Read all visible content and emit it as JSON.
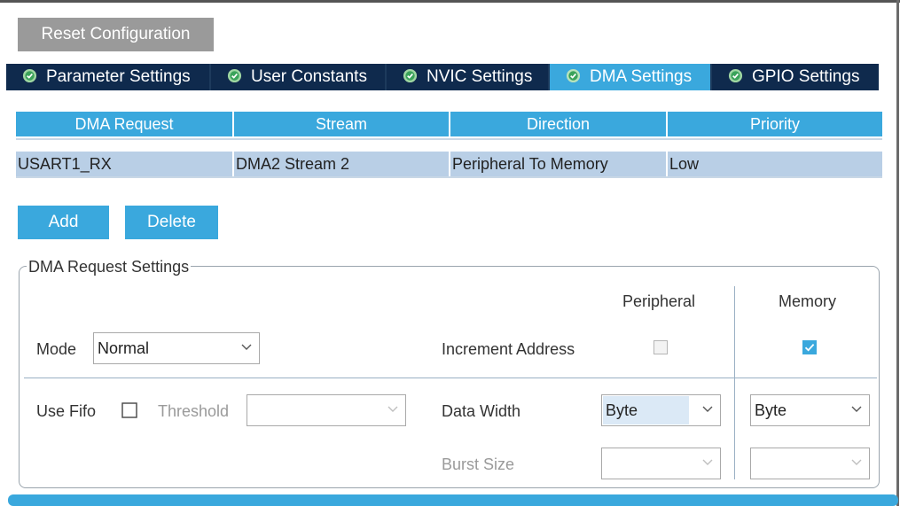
{
  "toolbar": {
    "reset_label": "Reset Configuration"
  },
  "tabs": [
    {
      "label": "Parameter Settings",
      "active": false
    },
    {
      "label": "User Constants",
      "active": false
    },
    {
      "label": "NVIC Settings",
      "active": false
    },
    {
      "label": "DMA Settings",
      "active": true
    },
    {
      "label": "GPIO Settings",
      "active": false
    }
  ],
  "dma_table": {
    "headers": [
      "DMA Request",
      "Stream",
      "Direction",
      "Priority"
    ],
    "rows": [
      [
        "USART1_RX",
        "DMA2 Stream 2",
        "Peripheral To Memory",
        "Low"
      ]
    ]
  },
  "actions": {
    "add_label": "Add",
    "delete_label": "Delete"
  },
  "request_settings": {
    "title": "DMA Request Settings",
    "peripheral_header": "Peripheral",
    "memory_header": "Memory",
    "mode_label": "Mode",
    "mode_value": "Normal",
    "increment_label": "Increment Address",
    "peripheral_increment": false,
    "memory_increment": true,
    "use_fifo_label": "Use Fifo",
    "use_fifo": false,
    "threshold_label": "Threshold",
    "threshold_value": "",
    "data_width_label": "Data Width",
    "peripheral_data_width": "Byte",
    "memory_data_width": "Byte",
    "burst_size_label": "Burst Size",
    "peripheral_burst": "",
    "memory_burst": ""
  },
  "icons": {
    "tab_status": "check-circle-icon",
    "dropdown": "chevron-down-icon",
    "checkbox": "checkbox-icon"
  },
  "colors": {
    "accent": "#3aa8dd",
    "tab_bg": "#0f2a4d",
    "row_bg": "#b9cfe6",
    "button_disabled": "#9a9a9a"
  }
}
